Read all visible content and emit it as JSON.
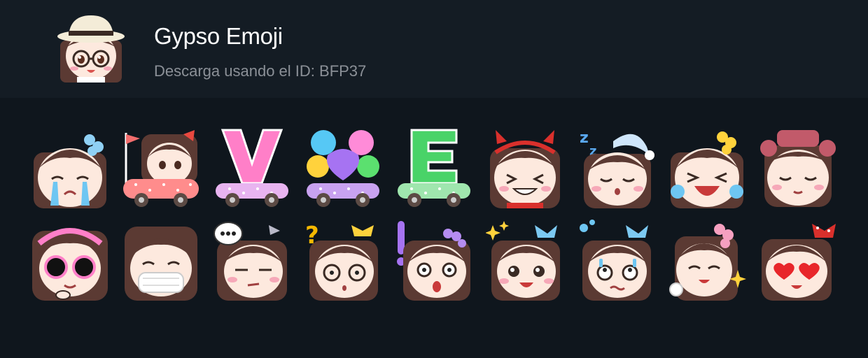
{
  "pack": {
    "title": "Gypso Emoji",
    "subtitle": "Descarga usando el ID: BFP37",
    "avatar_icon": "girl-with-sunhat-and-glasses-icon"
  },
  "colors": {
    "background": "#0f161d",
    "header": "#141c24",
    "hair": "#5b3a33",
    "skin": "#fde9de",
    "blush": "#f6a8b8",
    "pink": "#ff7fc8",
    "mint": "#49d368",
    "tear": "#6ec6f2"
  },
  "stickers": [
    {
      "icon": "crying-girl-icon"
    },
    {
      "icon": "girl-in-car-with-flag-icon"
    },
    {
      "icon": "letter-v-car-icon"
    },
    {
      "icon": "heart-balloons-car-icon"
    },
    {
      "icon": "letter-e-car-icon"
    },
    {
      "icon": "devil-horns-girl-icon"
    },
    {
      "icon": "sleeping-girl-zzz-icon"
    },
    {
      "icon": "laughing-girl-tears-icon"
    },
    {
      "icon": "hair-rollers-girl-icon"
    },
    {
      "icon": "sunglasses-girl-icon"
    },
    {
      "icon": "face-mask-girl-icon"
    },
    {
      "icon": "annoyed-girl-speech-dots-icon"
    },
    {
      "icon": "confused-girl-question-icon"
    },
    {
      "icon": "surprised-girl-exclamation-icon"
    },
    {
      "icon": "happy-girl-sparkles-icon"
    },
    {
      "icon": "nervous-girl-sweat-icon"
    },
    {
      "icon": "smiling-girl-star-icon"
    },
    {
      "icon": "heart-eyes-girl-icon"
    }
  ]
}
